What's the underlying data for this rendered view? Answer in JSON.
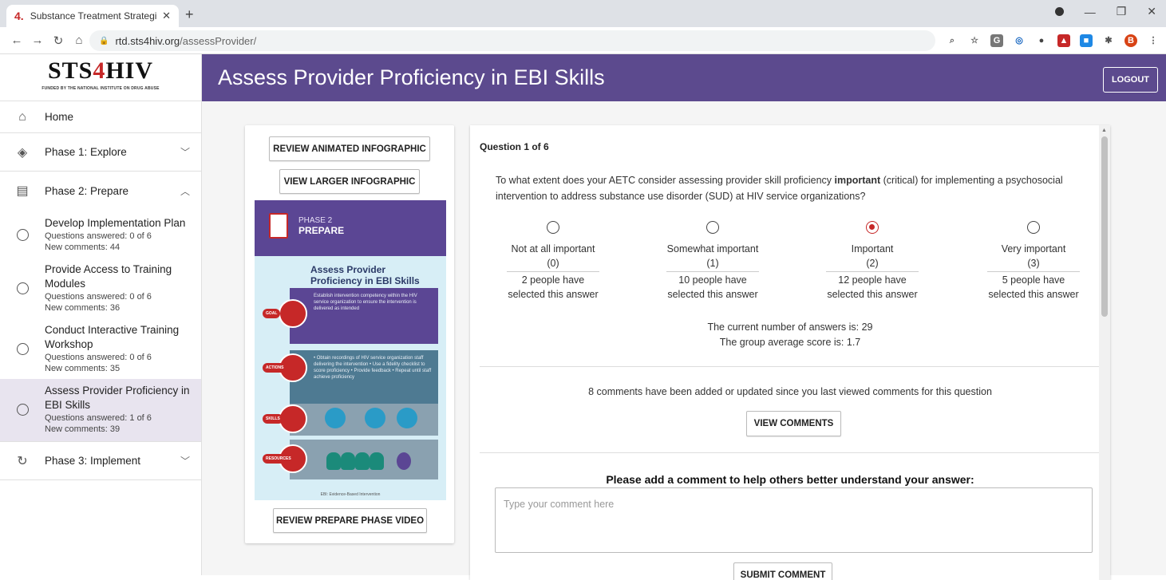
{
  "browser": {
    "tab_title": "Substance Treatment Strategies f",
    "url_host": "rtd.sts4hiv.org",
    "url_path": "/assessProvider/"
  },
  "logo": {
    "prefix": "STS",
    "four": "4",
    "suffix": "HIV",
    "subtitle": "FUNDED BY THE NATIONAL INSTITUTE ON DRUG ABUSE"
  },
  "sidebar": {
    "home": "Home",
    "phase1": "Phase 1: Explore",
    "phase2": "Phase 2: Prepare",
    "phase3": "Phase 3: Implement",
    "items": [
      {
        "title": "Develop Implementation Plan",
        "answered": "Questions answered: 0 of 6",
        "comments": "New comments: 44"
      },
      {
        "title": "Provide Access to Training Modules",
        "answered": "Questions answered: 0 of 6",
        "comments": "New comments: 36"
      },
      {
        "title": "Conduct Interactive Training Workshop",
        "answered": "Questions answered: 0 of 6",
        "comments": "New comments: 35"
      },
      {
        "title": "Assess Provider Proficiency in EBI Skills",
        "answered": "Questions answered: 1 of 6",
        "comments": "New comments: 39"
      }
    ]
  },
  "header": {
    "title": "Assess Provider Proficiency in EBI Skills",
    "logout": "LOGOUT"
  },
  "infocard": {
    "review_animated": "REVIEW ANIMATED INFOGRAPHIC",
    "view_larger": "VIEW LARGER INFOGRAPHIC",
    "review_video": "REVIEW PREPARE PHASE VIDEO",
    "graphic": {
      "phase_label": "PHASE 2",
      "phase_name": "PREPARE",
      "title_line1": "Assess Provider",
      "title_line2": "Proficiency in EBI Skills",
      "goal_tag": "GOAL",
      "goal_text": "Establish intervention competency within the HIV service organization to ensure the intervention is delivered as intended",
      "actions_tag": "ACTIONS",
      "actions_text": "• Obtain recordings of HIV service organization staff delivering the intervention • Use a fidelity checklist to score proficiency • Provide feedback • Repeat until staff achieve proficiency",
      "skills_tag": "SKILLS",
      "resources_tag": "RESOURCES",
      "footnote": "EBI: Evidence-Based Intervention"
    }
  },
  "question": {
    "number": "Question 1 of 6",
    "text_before": "To what extent does your AETC consider assessing provider skill proficiency ",
    "text_bold": "important",
    "text_after": " (critical) for implementing a psychosocial intervention to address substance use disorder (SUD) at HIV service organizations?",
    "options": [
      {
        "label": "Not at all important",
        "value": "(0)",
        "count_line1": "2 people have",
        "count_line2": "selected this answer",
        "selected": false
      },
      {
        "label": "Somewhat important",
        "value": "(1)",
        "count_line1": "10 people have",
        "count_line2": "selected this answer",
        "selected": false
      },
      {
        "label": "Important",
        "value": "(2)",
        "count_line1": "12 people have",
        "count_line2": "selected this answer",
        "selected": true
      },
      {
        "label": "Very important",
        "value": "(3)",
        "count_line1": "5 people have",
        "count_line2": "selected this answer",
        "selected": false
      }
    ],
    "answers_count": "The current number of answers is: 29",
    "group_average": "The group average score is: 1.7",
    "new_comments": "8 comments have been added or updated since you last viewed comments for this question",
    "view_comments": "VIEW COMMENTS",
    "add_comment_prompt": "Please add a comment to help others better understand your answer:",
    "comment_placeholder": "Type your comment here",
    "submit_comment": "SUBMIT COMMENT"
  },
  "colors": {
    "header": "#5c4a8e",
    "accent_red": "#c62828",
    "active_item": "#e8e4ef"
  }
}
